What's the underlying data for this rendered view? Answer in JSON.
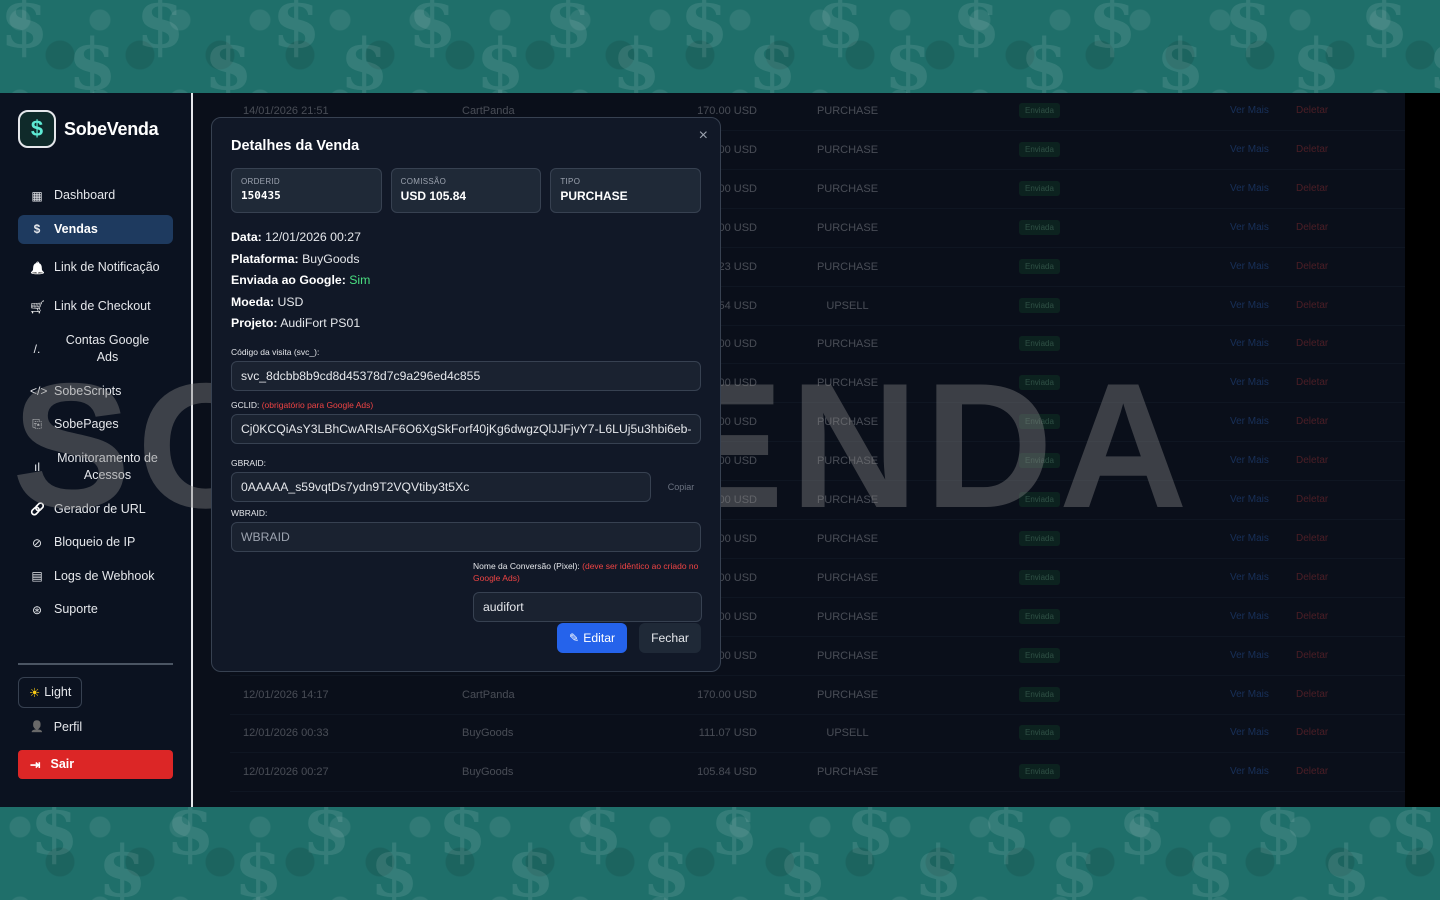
{
  "brand": {
    "name": "SobeVenda",
    "logo_glyph": "$"
  },
  "sidebar": {
    "items": [
      {
        "label": "Dashboard",
        "icon": "grid-icon",
        "glyph": "▦"
      },
      {
        "label": "Vendas",
        "icon": "dollar-icon",
        "glyph": "$"
      },
      {
        "label": "Link de Notificação",
        "icon": "bell-icon",
        "glyph": "🔔"
      },
      {
        "label": "Link de Checkout",
        "icon": "cart-icon",
        "glyph": "🛒"
      },
      {
        "label": "Contas Google Ads",
        "icon": "google-ads-icon",
        "glyph": "/."
      },
      {
        "label": "SobeScripts",
        "icon": "code-icon",
        "glyph": "</>"
      },
      {
        "label": "SobePages",
        "icon": "pages-icon",
        "glyph": "⎘"
      },
      {
        "label": "Monitoramento de Acessos",
        "icon": "chart-icon",
        "glyph": "ıl"
      },
      {
        "label": "Gerador de URL",
        "icon": "link-icon",
        "glyph": "🔗"
      },
      {
        "label": "Bloqueio de IP",
        "icon": "block-icon",
        "glyph": "⊘"
      },
      {
        "label": "Logs de Webhook",
        "icon": "file-icon",
        "glyph": "▤"
      },
      {
        "label": "Suporte",
        "icon": "lifebuoy-icon",
        "glyph": "⊛"
      }
    ],
    "theme_label": "Light",
    "theme_glyph": "☀",
    "profile_label": "Perfil",
    "profile_glyph": "👤",
    "logout_label": "Sair",
    "logout_glyph": "⇥"
  },
  "watermark": "SOBEVENDA",
  "table": {
    "rows": [
      {
        "date": "14/01/2026 21:51",
        "platform": "CartPanda",
        "value": "170.00 USD",
        "type": "PURCHASE"
      },
      {
        "date": "",
        "platform": "",
        "value": "00 USD",
        "type": "PURCHASE"
      },
      {
        "date": "",
        "platform": "",
        "value": "00 USD",
        "type": "PURCHASE"
      },
      {
        "date": "",
        "platform": "",
        "value": "00 USD",
        "type": "PURCHASE"
      },
      {
        "date": "",
        "platform": "",
        "value": "23 USD",
        "type": "PURCHASE"
      },
      {
        "date": "",
        "platform": "",
        "value": "54 USD",
        "type": "UPSELL"
      },
      {
        "date": "",
        "platform": "",
        "value": "00 USD",
        "type": "PURCHASE"
      },
      {
        "date": "",
        "platform": "",
        "value": "00 USD",
        "type": "PURCHASE"
      },
      {
        "date": "",
        "platform": "",
        "value": "00 USD",
        "type": "PURCHASE"
      },
      {
        "date": "",
        "platform": "",
        "value": "00 USD",
        "type": "PURCHASE"
      },
      {
        "date": "",
        "platform": "",
        "value": "00 USD",
        "type": "PURCHASE"
      },
      {
        "date": "",
        "platform": "",
        "value": "00 USD",
        "type": "PURCHASE"
      },
      {
        "date": "",
        "platform": "",
        "value": "00 USD",
        "type": "PURCHASE"
      },
      {
        "date": "",
        "platform": "",
        "value": "00 USD",
        "type": "PURCHASE"
      },
      {
        "date": "",
        "platform": "",
        "value": "00 USD",
        "type": "PURCHASE"
      },
      {
        "date": "12/01/2026 14:17",
        "platform": "CartPanda",
        "value": "170.00 USD",
        "type": "PURCHASE"
      },
      {
        "date": "12/01/2026 00:33",
        "platform": "BuyGoods",
        "value": "111.07 USD",
        "type": "UPSELL"
      },
      {
        "date": "12/01/2026 00:27",
        "platform": "BuyGoods",
        "value": "105.84 USD",
        "type": "PURCHASE"
      }
    ],
    "status_label": "Enviada",
    "more_label": "Ver Mais",
    "delete_label": "Deletar"
  },
  "modal": {
    "title": "Detalhes da Venda",
    "close_glyph": "×",
    "cards": [
      {
        "label": "ORDERID",
        "value": "150435"
      },
      {
        "label": "COMISSÃO",
        "value": "USD 105.84"
      },
      {
        "label": "TIPO",
        "value": "PURCHASE"
      }
    ],
    "info": {
      "data_label": "Data:",
      "data_value": "12/01/2026 00:27",
      "plataforma_label": "Plataforma:",
      "plataforma_value": "BuyGoods",
      "enviada_label": "Enviada ao Google:",
      "enviada_value": "Sim",
      "moeda_label": "Moeda:",
      "moeda_value": "USD",
      "projeto_label": "Projeto:",
      "projeto_value": "AudiFort PS01"
    },
    "svc_label": "Código da visita (svc_):",
    "svc_value": "svc_8dcbb8b9cd8d45378d7c9a296ed4c855",
    "gclid_label": "GCLID:",
    "gclid_note": "(obrigatório para Google Ads)",
    "gclid_value": "Cj0KCQiAsY3LBhCwARIsAF6O6XgSkForf40jKg6dwgzQlJJFjvY7-L6LUj5u3hbi6eb-",
    "gbraid_label": "GBRAID:",
    "gbraid_value": "0AAAAA_s59vqtDs7ydn9T2VQVtiby3t5Xc",
    "copy_label": "Copiar",
    "wbraid_label": "WBRAID:",
    "wbraid_placeholder": "WBRAID",
    "conversion_label": "Nome da Conversão (Pixel):",
    "conversion_note": "(deve ser idêntico ao criado no Google Ads)",
    "conversion_value": "audifort",
    "edit_label": "Editar",
    "edit_glyph": "✎",
    "close_label": "Fechar"
  }
}
